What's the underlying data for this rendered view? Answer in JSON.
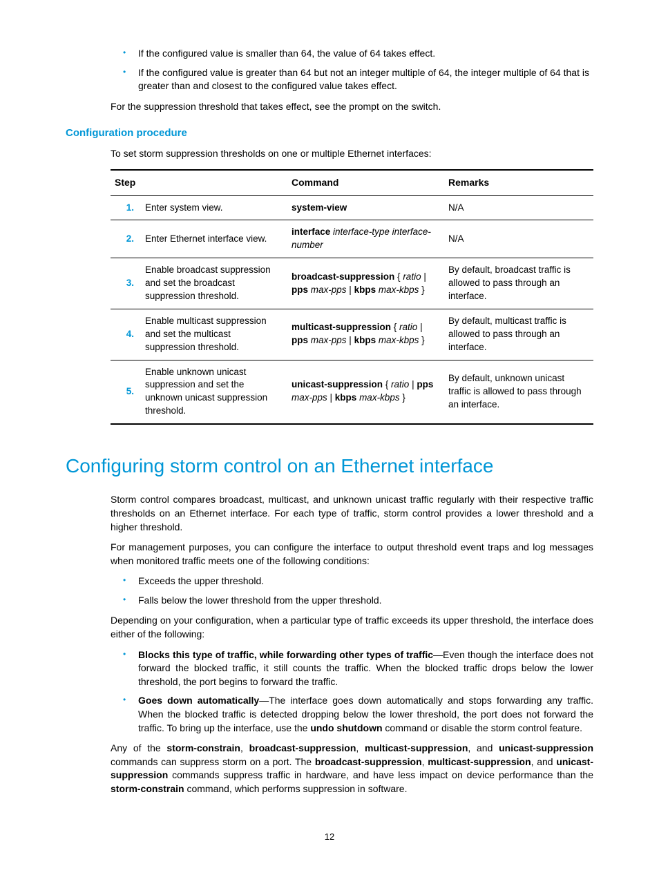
{
  "top_bullets": [
    "If the configured value is smaller than 64, the value of 64 takes effect.",
    "If the configured value is greater than 64 but not an integer multiple of 64, the integer multiple of 64 that is greater than and closest to the configured value takes effect."
  ],
  "para1": "For the suppression threshold that takes effect, see the prompt on the switch.",
  "subheading": "Configuration procedure",
  "para2": "To set storm suppression thresholds on one or multiple Ethernet interfaces:",
  "table": {
    "headers": [
      "Step",
      "Command",
      "Remarks"
    ],
    "rows": [
      {
        "num": "1.",
        "step": "Enter system view.",
        "cmd_html": "<b>system-view</b>",
        "remarks": "N/A"
      },
      {
        "num": "2.",
        "step": "Enter Ethernet interface view.",
        "cmd_html": "<b>interface</b> <i>interface-type interface-number</i>",
        "remarks": "N/A"
      },
      {
        "num": "3.",
        "step": "Enable broadcast suppression and set the broadcast suppression threshold.",
        "cmd_html": "<b>broadcast-suppression</b> { <i>ratio</i> | <b>pps</b> <i>max-pps</i> | <b>kbps</b> <i>max-kbps</i> }",
        "remarks": "By default, broadcast traffic is allowed to pass through an interface."
      },
      {
        "num": "4.",
        "step": "Enable multicast suppression and set the multicast suppression threshold.",
        "cmd_html": "<b>multicast-suppression</b> { <i>ratio</i> | <b>pps</b> <i>max-pps</i> | <b>kbps</b> <i>max-kbps</i> }",
        "remarks": "By default, multicast traffic is allowed to pass through an interface."
      },
      {
        "num": "5.",
        "step": "Enable unknown unicast suppression and set the unknown unicast suppression threshold.",
        "cmd_html": "<b>unicast-suppression</b> { <i>ratio</i> | <b>pps</b> <i>max-pps</i> | <b>kbps</b> <i>max-kbps</i> }",
        "remarks": "By default, unknown unicast traffic is allowed to pass through an interface."
      }
    ]
  },
  "h1": "Configuring storm control on an Ethernet interface",
  "para3": "Storm control compares broadcast, multicast, and unknown unicast traffic regularly with their respective traffic thresholds on an Ethernet interface. For each type of traffic, storm control provides a lower threshold and a higher threshold.",
  "para4": "For management purposes, you can configure the interface to output threshold event traps and log messages when monitored traffic meets one of the following conditions:",
  "bullets2": [
    "Exceeds the upper threshold.",
    "Falls below the lower threshold from the upper threshold."
  ],
  "para5": "Depending on your configuration, when a particular type of traffic exceeds its upper threshold, the interface does either of the following:",
  "bullets3": [
    {
      "bold": "Blocks this type of traffic, while forwarding other types of traffic",
      "rest": "—Even though the interface does not forward the blocked traffic, it still counts the traffic. When the blocked traffic drops below the lower threshold, the port begins to forward the traffic."
    },
    {
      "bold": "Goes down automatically",
      "rest_html": "—The interface goes down automatically and stops forwarding any traffic. When the blocked traffic is detected dropping below the lower threshold, the port does not forward the traffic. To bring up the interface, use the <b>undo shutdown</b> command or disable the storm control feature."
    }
  ],
  "para6_html": "Any of the <b>storm-constrain</b>, <b>broadcast-suppression</b>, <b>multicast-suppression</b>, and <b>unicast-suppression</b> commands can suppress storm on a port. The <b>broadcast-suppression</b>, <b>multicast-suppression</b>, and <b>unicast-suppression</b> commands suppress traffic in hardware, and have less impact on device performance than the <b>storm-constrain</b> command, which performs suppression in software.",
  "page_number": "12"
}
